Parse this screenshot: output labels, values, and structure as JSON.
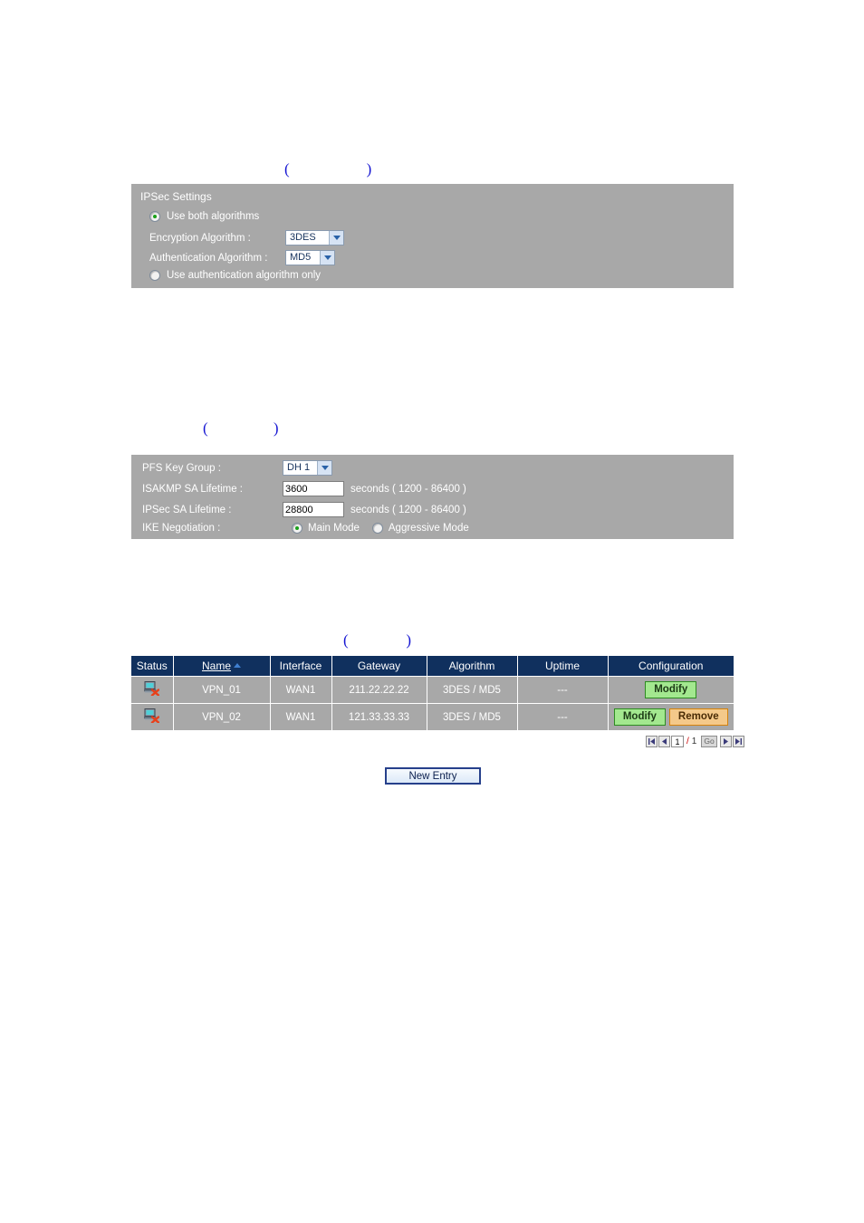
{
  "annotations": [
    {
      "id": "caption1",
      "text": "(                    )"
    },
    {
      "id": "caption2",
      "text": "(                 )"
    },
    {
      "id": "caption3",
      "text": "(               )"
    }
  ],
  "ipsec_panel": {
    "title": "IPSec Settings",
    "option_both": "Use both algorithms",
    "encryption_label": "Encryption Algorithm :",
    "encryption_value": "3DES",
    "authentication_label": "Authentication Algorithm :",
    "authentication_value": "MD5",
    "option_auth_only": "Use authentication algorithm only",
    "selected_option": "both"
  },
  "advanced_panel": {
    "pfs_label": "PFS Key Group :",
    "pfs_value": "DH 1",
    "isakmp_label": "ISAKMP SA Lifetime :",
    "isakmp_value": "3600",
    "isakmp_hint": "seconds ( 1200 - 86400 )",
    "ipsec_label": "IPSec SA Lifetime :",
    "ipsec_value": "28800",
    "ipsec_hint": "seconds ( 1200 - 86400 )",
    "ike_label": "IKE Negotiation :",
    "ike_main": "Main Mode",
    "ike_aggressive": "Aggressive Mode",
    "ike_selected": "main"
  },
  "table": {
    "columns": [
      "Status",
      "Name",
      "Interface",
      "Gateway",
      "Algorithm",
      "Uptime",
      "Configuration"
    ],
    "sorted_column": "Name",
    "sort_direction": "asc",
    "rows": [
      {
        "status_icon": "computer-disconnected-icon",
        "name": "VPN_01",
        "interface": "WAN1",
        "gateway": "211.22.22.22",
        "algorithm": "3DES / MD5",
        "uptime": "---",
        "actions": [
          "Modify"
        ]
      },
      {
        "status_icon": "computer-disconnected-icon",
        "name": "VPN_02",
        "interface": "WAN1",
        "gateway": "121.33.33.33",
        "algorithm": "3DES / MD5",
        "uptime": "---",
        "actions": [
          "Modify",
          "Remove"
        ]
      }
    ],
    "action_labels": {
      "modify": "Modify",
      "remove": "Remove"
    }
  },
  "pager": {
    "current_page": "1",
    "separator": "/",
    "total_pages": "1",
    "go_label": "Go",
    "first_label": "first-page-icon",
    "prev_label": "previous-page-icon",
    "next_label": "next-page-icon",
    "last_label": "last-page-icon"
  },
  "footer": {
    "new_entry_label": "New Entry"
  },
  "colors": {
    "panel_bg": "#a8a8a8",
    "header_bg": "#10305e",
    "accent_blue": "#1414d2",
    "modify_bg": "#a3e88f",
    "modify_border": "#2e8b22",
    "remove_bg": "#f4c98a",
    "remove_border": "#d4820c"
  }
}
